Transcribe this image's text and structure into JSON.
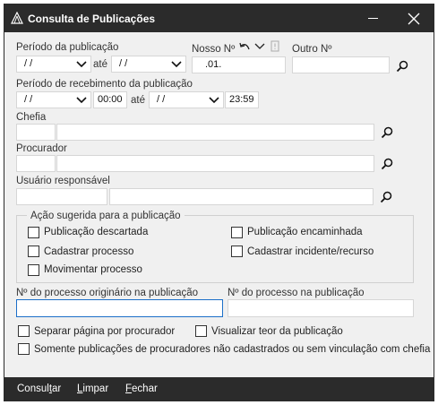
{
  "window": {
    "title": "Consulta de Publicações"
  },
  "periodo_publicacao": {
    "label": "Período da publicação",
    "date_from": " / /",
    "ate": "até",
    "date_to": " / /"
  },
  "nosso_numero": {
    "label": "Nosso Nº",
    "value": ".01."
  },
  "outro_numero": {
    "label": "Outro Nº",
    "value": ""
  },
  "periodo_recebimento": {
    "label": "Período de recebimento da publicação",
    "date_from": " / /",
    "time_from": "00:00",
    "ate": "até",
    "date_to": " / /",
    "time_to": "23:59"
  },
  "chefia": {
    "label": "Chefia",
    "code": "",
    "name": ""
  },
  "procurador": {
    "label": "Procurador",
    "code": "",
    "name": ""
  },
  "usuario": {
    "label": "Usuário responsável",
    "code": "",
    "name": ""
  },
  "acao": {
    "title": "Ação sugerida para a publicação",
    "options": [
      {
        "label": "Publicação descartada",
        "checked": false
      },
      {
        "label": "Publicação encaminhada",
        "checked": false
      },
      {
        "label": "Cadastrar processo",
        "checked": false
      },
      {
        "label": "Cadastrar incidente/recurso",
        "checked": false
      },
      {
        "label": "Movimentar processo",
        "checked": false
      }
    ]
  },
  "processo_originario": {
    "label": "Nº do processo originário na publicação",
    "value": ""
  },
  "processo_publicacao": {
    "label": "Nº do processo na publicação",
    "value": ""
  },
  "options": {
    "separar": {
      "label": "Separar página por procurador",
      "checked": false
    },
    "visualizar": {
      "label": "Visualizar teor da publicação",
      "checked": false
    },
    "somente": {
      "label": "Somente publicações de procuradores não cadastrados ou sem vinculação com chefia",
      "checked": false
    }
  },
  "footer": {
    "consultar": {
      "prefix": "Consul",
      "underlined": "t",
      "suffix": "ar"
    },
    "limpar": {
      "prefix": "",
      "underlined": "L",
      "suffix": "impar"
    },
    "fechar": {
      "prefix": "",
      "underlined": "F",
      "suffix": "echar"
    }
  },
  "icons": {
    "search": "magnifier-icon",
    "undo": "undo-arrow-icon",
    "dropdown": "chevron-down-icon",
    "extra": "info-box-icon"
  }
}
